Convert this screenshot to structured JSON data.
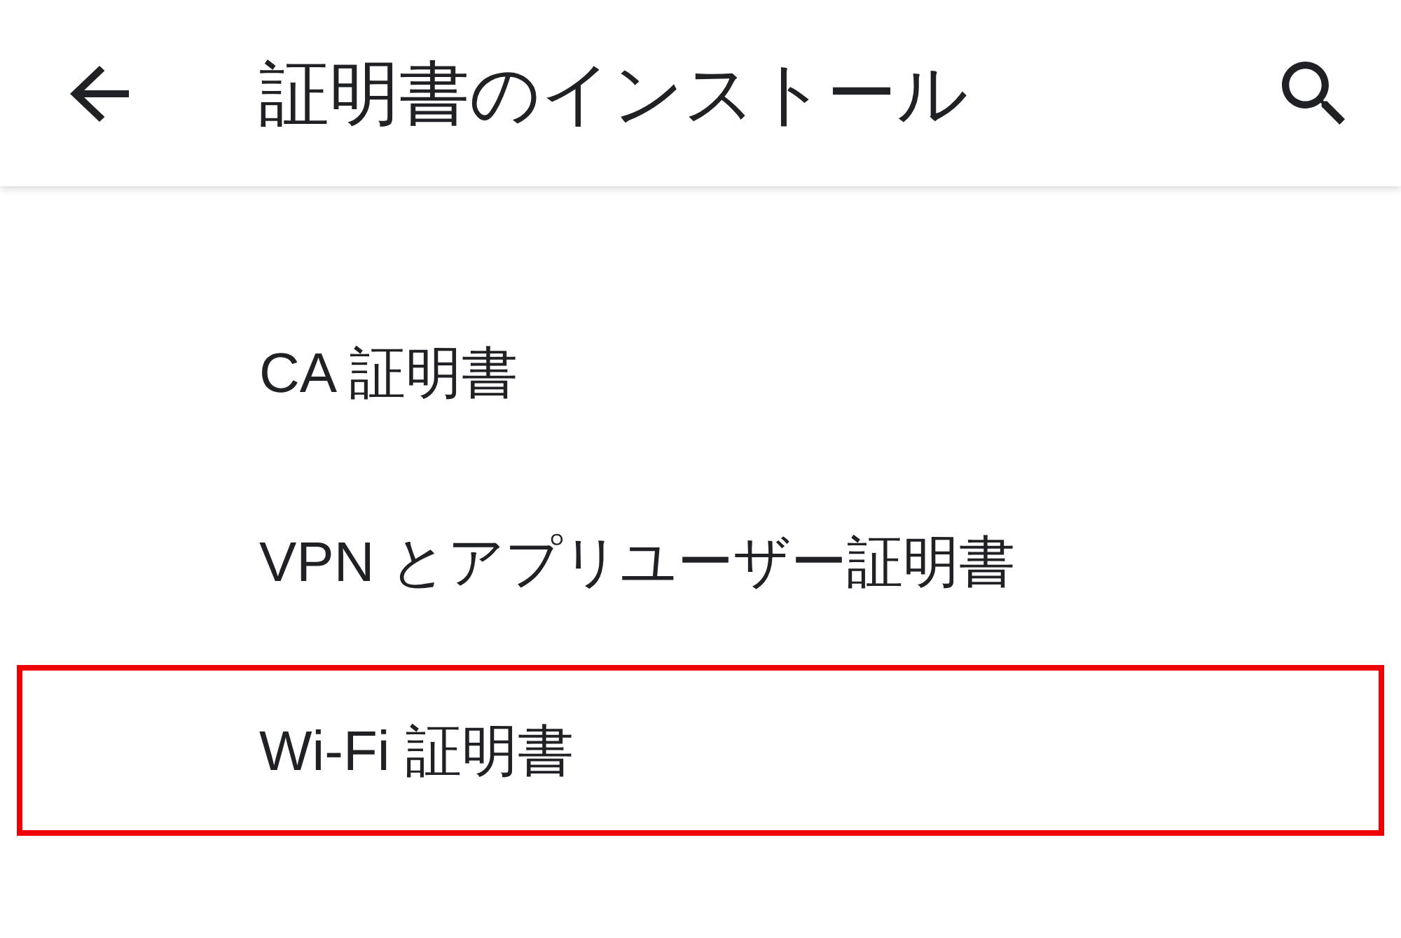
{
  "app_bar": {
    "title": "証明書のインストール"
  },
  "items": [
    {
      "label": "CA 証明書",
      "highlighted": false
    },
    {
      "label": "VPN とアプリユーザー証明書",
      "highlighted": false
    },
    {
      "label": "Wi-Fi 証明書",
      "highlighted": true
    }
  ]
}
